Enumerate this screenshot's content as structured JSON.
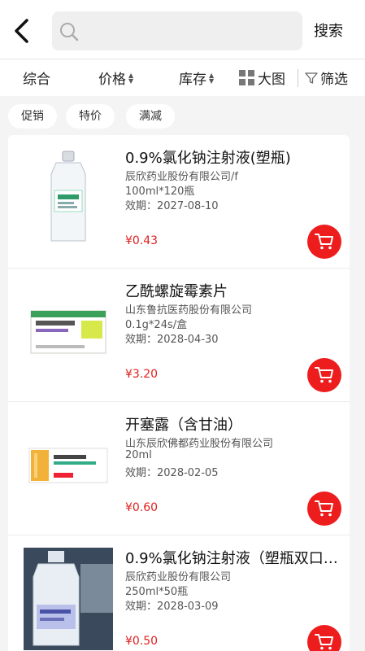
{
  "header": {
    "search_placeholder": "",
    "search_button": "搜索",
    "colors": {
      "accent": "#ee1d1d",
      "price": "#e02020"
    }
  },
  "sort": {
    "items": [
      "综合",
      "价格",
      "库存",
      "大图",
      "筛选"
    ]
  },
  "filters": {
    "tags": [
      "促销",
      "特价",
      "满减"
    ]
  },
  "products": [
    {
      "name": "0.9%氯化钠注射液(塑瓶)",
      "company": "辰欣药业股份有限公司/f",
      "spec": "100ml*120瓶",
      "expiry": "效期：2027-08-10",
      "price": "¥0.43",
      "image": "iv-bottle"
    },
    {
      "name": "乙酰螺旋霉素片",
      "company": "山东鲁抗医药股份有限公司",
      "spec": "0.1g*24s/盒",
      "expiry": "效期：2028-04-30",
      "price": "¥3.20",
      "image": "pill-box"
    },
    {
      "name": "开塞露（含甘油）",
      "company": "山东辰欣佛都药业股份有限公司",
      "spec": "20ml",
      "expiry": "效期：2028-02-05",
      "price": "¥0.60",
      "image": "medicine-box"
    },
    {
      "name": "0.9%氯化钠注射液（塑瓶双口…",
      "company": "辰欣药业股份有限公司",
      "spec": "250ml*50瓶",
      "expiry": "效期：2028-03-09",
      "price": "¥0.50",
      "image": "iv-bottle-photo"
    }
  ]
}
